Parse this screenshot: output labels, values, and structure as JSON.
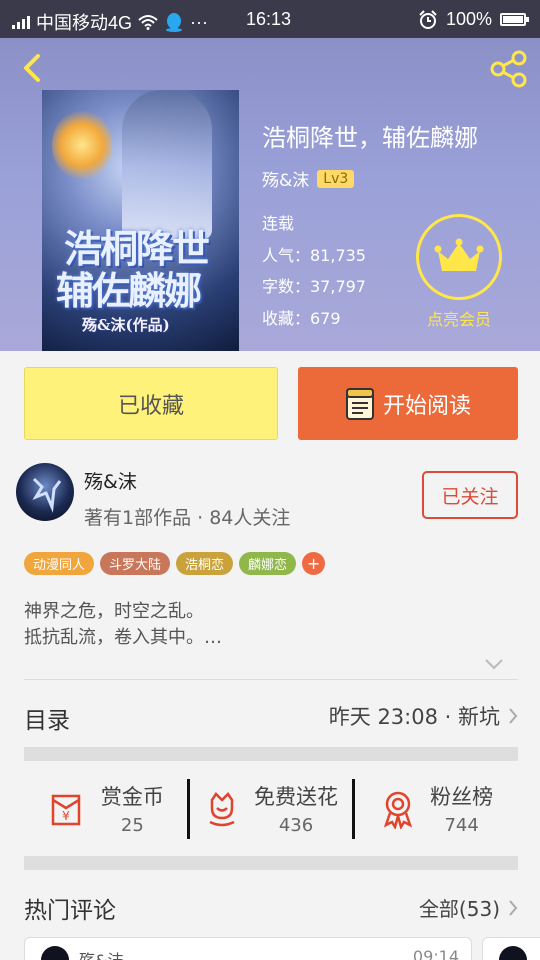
{
  "status_bar": {
    "carrier": "中国移动4G",
    "more": "···",
    "time": "16:13",
    "battery": "100%"
  },
  "book": {
    "title": "浩桐降世，辅佐麟娜",
    "author": "殇&沫",
    "level": "Lv3",
    "status": "连载",
    "popularity": "人气：81,735",
    "word_count": "字数：37,797",
    "favorites": "收藏：679",
    "cover": {
      "title_line1": "浩桐降世",
      "title_line2": "辅佐麟娜",
      "author": "殇&沫(作品)"
    },
    "vip_label": "点亮会员"
  },
  "actions": {
    "collected_label": "已收藏",
    "read_label": "开始阅读"
  },
  "author_info": {
    "name": "殇&沫",
    "stats": "著有1部作品 · 84人关注",
    "follow_label": "已关注"
  },
  "tags": [
    {
      "label": "动漫同人",
      "color": "#f0a63c"
    },
    {
      "label": "斗罗大陆",
      "color": "#c9775a"
    },
    {
      "label": "浩桐恋",
      "color": "#c9a23c"
    },
    {
      "label": "麟娜恋",
      "color": "#8fb74a"
    }
  ],
  "synopsis": {
    "line1": "神界之危，时空之乱。",
    "line2": "抵抗乱流，卷入其中。…"
  },
  "toc": {
    "title": "目录",
    "update": "昨天 23:08 · 新坑"
  },
  "stats": [
    {
      "label": "赏金币",
      "value": "25",
      "icon": "red-envelope-icon"
    },
    {
      "label": "免费送花",
      "value": "436",
      "icon": "flower-icon"
    },
    {
      "label": "粉丝榜",
      "value": "744",
      "icon": "medal-icon"
    }
  ],
  "hot_comments": {
    "title": "热门评论",
    "all_label": "全部(53)",
    "first_comment": {
      "user": "殇&沫",
      "time": "09:14"
    }
  },
  "colors": {
    "accent_orange": "#ec6a3a",
    "collected_yellow": "#fff27a",
    "vip_yellow": "#ffe74a",
    "follow_red": "#d94c36",
    "icon_red": "#e0442c"
  }
}
